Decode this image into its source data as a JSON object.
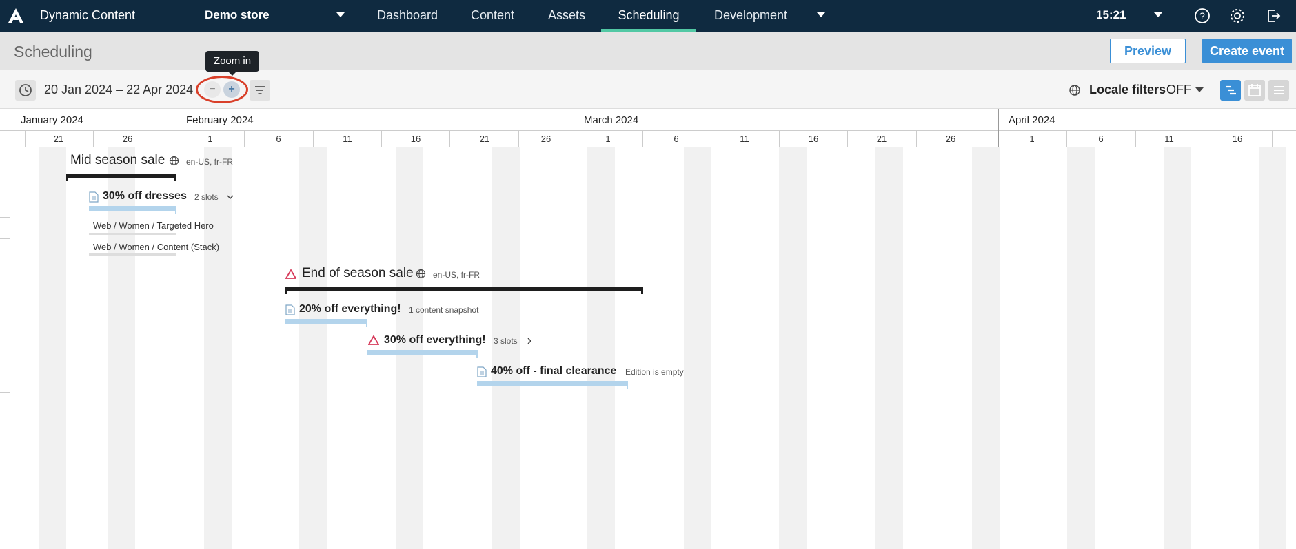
{
  "topbar": {
    "app_name": "Dynamic Content",
    "store": "Demo store",
    "nav": [
      "Dashboard",
      "Content",
      "Assets",
      "Scheduling",
      "Development"
    ],
    "active_nav": "Scheduling",
    "time": "15:21",
    "icons": [
      "logo-icon",
      "help-icon",
      "gear-icon",
      "logout-icon"
    ]
  },
  "subheader": {
    "title": "Scheduling",
    "preview_label": "Preview",
    "create_label": "Create event"
  },
  "toolbar": {
    "date_range": "20 Jan 2024 – 22 Apr 2024",
    "zoom_out": "−",
    "zoom_in": "+",
    "tooltip": "Zoom in",
    "locale_label": "Locale filters",
    "locale_value": "OFF"
  },
  "timeline": {
    "months": [
      "January 2024",
      "February 2024",
      "March 2024",
      "April 2024"
    ],
    "days_jan": [
      "21",
      "26"
    ],
    "days_feb": [
      "1",
      "6",
      "11",
      "16",
      "21",
      "26"
    ],
    "days_mar": [
      "1",
      "6",
      "11",
      "16",
      "21",
      "26"
    ],
    "days_apr": [
      "1",
      "6",
      "11",
      "16"
    ]
  },
  "events": [
    {
      "title": "Mid season sale",
      "locales": "en-US, fr-FR",
      "editions": [
        {
          "title": "30% off dresses",
          "note": "2 slots",
          "slots": [
            "Web / Women / Targeted Hero",
            "Web / Women / Content (Stack)"
          ]
        }
      ]
    },
    {
      "title": "End of season sale",
      "locales": "en-US, fr-FR",
      "editions": [
        {
          "title": "20% off everything!",
          "note": "1 content snapshot"
        },
        {
          "title": "30% off everything!",
          "note": "3 slots"
        },
        {
          "title": "40% off - final clearance",
          "note": "Edition is empty"
        }
      ]
    }
  ],
  "colors": {
    "topbar": "#0f2a40",
    "accent": "#3a8fd6",
    "active_tab": "#52c8a4",
    "edition_bar": "#b3d4ec",
    "warning": "#d63a5a"
  }
}
